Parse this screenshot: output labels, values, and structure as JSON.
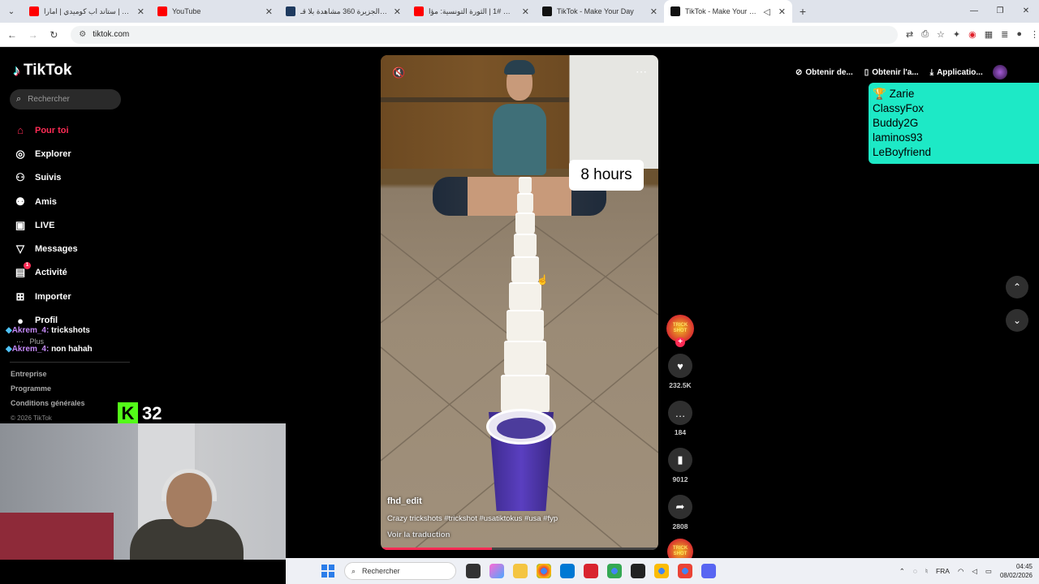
{
  "browser": {
    "tabs": [
      {
        "label": "ميثا نادر | ستاند اب كوميدي | امارا",
        "favcolor": "#ff0000",
        "active": false
      },
      {
        "label": "YouTube",
        "favcolor": "#ff0000",
        "active": false
      },
      {
        "label": "منصة الجزيرة 360 مشاهدة بلا قـ",
        "favcolor": "#1e3a5f",
        "active": false
      },
      {
        "label": "مؤامرات #1 | الثورة التونسية: مؤا",
        "favcolor": "#ff0000",
        "active": false
      },
      {
        "label": "TikTok - Make Your Day",
        "favcolor": "#111111",
        "active": false
      },
      {
        "label": "TikTok - Make Your Day",
        "favcolor": "#111111",
        "active": true
      }
    ],
    "url": "tiktok.com"
  },
  "sidebar": {
    "brand": "TikTok",
    "search_placeholder": "Rechercher",
    "nav": [
      {
        "label": "Pour toi",
        "icon": "home-icon",
        "glyph": "⌂",
        "active": true
      },
      {
        "label": "Explorer",
        "icon": "compass-icon",
        "glyph": "◎",
        "active": false
      },
      {
        "label": "Suivis",
        "icon": "following-icon",
        "glyph": "⚇",
        "active": false
      },
      {
        "label": "Amis",
        "icon": "friends-icon",
        "glyph": "⚉",
        "active": false
      },
      {
        "label": "LIVE",
        "icon": "live-icon",
        "glyph": "▣",
        "active": false
      },
      {
        "label": "Messages",
        "icon": "send-icon",
        "glyph": "▽",
        "active": false
      },
      {
        "label": "Activité",
        "icon": "activity-icon",
        "glyph": "▤",
        "active": false,
        "badge": "1"
      },
      {
        "label": "Importer",
        "icon": "upload-icon",
        "glyph": "⊞",
        "active": false
      },
      {
        "label": "Profil",
        "icon": "profile-icon",
        "glyph": "●",
        "active": false
      }
    ],
    "more": "Plus",
    "footer": [
      "Entreprise",
      "Programme",
      "Conditions générales"
    ],
    "copyright": "© 2026 TikTok"
  },
  "chat": [
    {
      "user": "Akrem_4:",
      "text": "trickshots"
    },
    {
      "user": "Akrem_4:",
      "text": "non hahah"
    }
  ],
  "kick": {
    "letter": "K",
    "count": "32"
  },
  "video": {
    "sticker": "8 hours",
    "username": "fhd_edit",
    "caption": "Crazy trickshots #trickshot #usatiktokus #usa #fyp",
    "translate": "Voir la traduction",
    "progress": 0.4
  },
  "actions": {
    "creator_badge": "TRICK SHOT",
    "likes": "232.5K",
    "comments": "184",
    "saves": "9012",
    "shares": "2808"
  },
  "header": {
    "get_coins": "Obtenir de...",
    "get_app": "Obtenir l'a...",
    "application": "Applicatio..."
  },
  "overlay_list": [
    "Zarie",
    "ClassyFox",
    "Buddy2G",
    "laminos93",
    "LeBoyfriend"
  ],
  "taskbar": {
    "search": "Rechercher",
    "lang": "FRA",
    "time": "04:45",
    "date": "08/02/2026"
  }
}
